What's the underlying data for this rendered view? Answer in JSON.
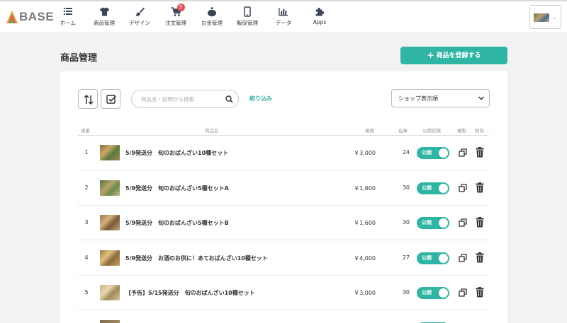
{
  "brand": {
    "logo_text": "BASE"
  },
  "nav": {
    "items": [
      {
        "label": "ホーム",
        "icon": "list-icon"
      },
      {
        "label": "商品管理",
        "icon": "shirt-icon"
      },
      {
        "label": "デザイン",
        "icon": "brush-icon"
      },
      {
        "label": "注文管理",
        "icon": "cart-icon",
        "badge": "5"
      },
      {
        "label": "お金管理",
        "icon": "money-bag-icon"
      },
      {
        "label": "販促管理",
        "icon": "phone-icon"
      },
      {
        "label": "データ",
        "icon": "bar-chart-icon"
      },
      {
        "label": "Apps",
        "icon": "puzzle-icon"
      }
    ]
  },
  "page": {
    "title": "商品管理",
    "register_button": "商品を登録する"
  },
  "toolbar": {
    "search_placeholder": "商品名・説明から検索",
    "filter_link": "絞り込み",
    "sort_value": "ショップ表示順"
  },
  "table": {
    "headers": {
      "num": "順番",
      "name": "商品名",
      "price": "価格",
      "stock": "在庫",
      "status": "公開状態",
      "copy": "複製",
      "delete": "削除"
    },
    "rows": [
      {
        "num": "1",
        "name": "5/9発送分　旬のおばんざい10種セット",
        "price": "￥3,000",
        "stock": "24",
        "status": "公開"
      },
      {
        "num": "2",
        "name": "5/9発送分　旬のおばんざい5種セットA",
        "price": "￥1,600",
        "stock": "30",
        "status": "公開"
      },
      {
        "num": "3",
        "name": "5/9発送分　旬のおばんざい5種セットB",
        "price": "￥1,600",
        "stock": "30",
        "status": "公開"
      },
      {
        "num": "4",
        "name": "5/9発送分　お酒のお供に！あておばんざい10種セット",
        "price": "￥4,000",
        "stock": "27",
        "status": "公開"
      },
      {
        "num": "5",
        "name": "【予告】5/15発送分　旬のおばんざい10種セット",
        "price": "￥3,000",
        "stock": "30",
        "status": "公開"
      }
    ]
  },
  "colors": {
    "accent": "#2fb5a3",
    "badge": "#e9505a",
    "nav_icon": "#3b4556"
  }
}
